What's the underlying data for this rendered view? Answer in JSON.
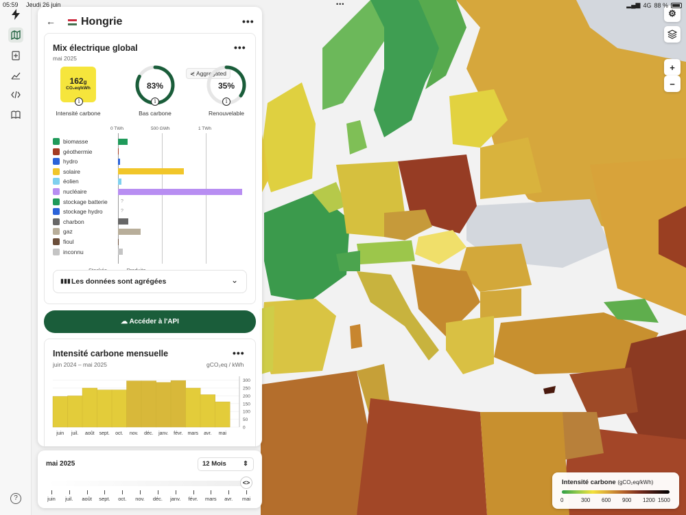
{
  "status_bar": {
    "time": "05:59",
    "date": "Jeudi 26 juin",
    "network": "4G",
    "battery": "88 %"
  },
  "header": {
    "country": "Hongrie"
  },
  "mix": {
    "title": "Mix électrique global",
    "period": "mai 2025",
    "aggregated_label": "Aggregated",
    "carbon_intensity": {
      "value": "162",
      "unit_g": "g",
      "unit": "CO₂eq/kWh",
      "label": "Intensité carbone"
    },
    "low_carbon": {
      "value": "83%",
      "fraction": 0.83,
      "label": "Bas carbone"
    },
    "renewable": {
      "value": "35%",
      "fraction": 0.35,
      "label": "Renouvelable"
    },
    "axis_ticks": [
      "0 TWh",
      "500 GWh",
      "1 TWh"
    ],
    "sources": [
      {
        "label": "biomasse",
        "value": 40,
        "color": "#1f9a5a",
        "icon": "leaf-icon",
        "unknown": false
      },
      {
        "label": "géothermie",
        "value": 2,
        "color": "#a43b22",
        "icon": "heat-icon",
        "unknown": false
      },
      {
        "label": "hydro",
        "value": 8,
        "color": "#2b63d9",
        "icon": "water-icon",
        "unknown": false
      },
      {
        "label": "solaire",
        "value": 265,
        "color": "#f1c62a",
        "icon": "sun-icon",
        "unknown": false
      },
      {
        "label": "éolien",
        "value": 14,
        "color": "#7fd0ee",
        "icon": "wind-icon",
        "unknown": false
      },
      {
        "label": "nucléaire",
        "value": 500,
        "color": "#b88ef2",
        "icon": "atom-icon",
        "unknown": false
      },
      {
        "label": "stockage batterie",
        "value": 0,
        "color": "#1f9a5a",
        "icon": "battery-icon",
        "unknown": true
      },
      {
        "label": "stockage hydro",
        "value": 0,
        "color": "#2b63d9",
        "icon": "dam-icon",
        "unknown": true
      },
      {
        "label": "charbon",
        "value": 42,
        "color": "#676767",
        "icon": "coal-icon",
        "unknown": false
      },
      {
        "label": "gaz",
        "value": 92,
        "color": "#b8ae9a",
        "icon": "gas-icon",
        "unknown": false
      },
      {
        "label": "fioul",
        "value": 2,
        "color": "#6b4e3a",
        "icon": "oil-icon",
        "unknown": false
      },
      {
        "label": "inconnu",
        "value": 18,
        "color": "#c4c4c4",
        "icon": "question-icon",
        "unknown": false
      }
    ],
    "unknown_mark": "?",
    "stored_label": "Stockée ←",
    "produced_label": "→ Produite",
    "aggregated_notice": "Les données sont agrégées"
  },
  "api_button": "Accéder à l'API",
  "monthly": {
    "title": "Intensité carbone mensuelle",
    "period": "juin 2024 – mai 2025",
    "unit": "gCO₂eq / kWh"
  },
  "chart_data": {
    "type": "bar",
    "categories": [
      "juin",
      "juil.",
      "août",
      "sept.",
      "oct.",
      "nov.",
      "déc.",
      "janv.",
      "févr.",
      "mars",
      "avr.",
      "mai"
    ],
    "values": [
      196,
      200,
      250,
      238,
      238,
      296,
      296,
      286,
      298,
      250,
      208,
      162
    ],
    "yticks": [
      0,
      50,
      100,
      150,
      200,
      250,
      300
    ],
    "ylim": [
      0,
      325
    ],
    "color": "#e3cc3a"
  },
  "timeline": {
    "current": "mai 2025",
    "range_select": "12 Mois",
    "handle": "<>",
    "months": [
      "juin",
      "juil.",
      "août",
      "sept.",
      "oct.",
      "nov.",
      "déc.",
      "janv.",
      "févr.",
      "mars",
      "avr.",
      "mai"
    ]
  },
  "legend": {
    "title": "Intensité carbone",
    "unit": "(gCO₂eq/kWh)",
    "ticks": [
      "0",
      "300",
      "600",
      "900",
      "1200",
      "1500"
    ]
  },
  "map_controls": {
    "zoom_in": "+",
    "zoom_out": "−"
  }
}
